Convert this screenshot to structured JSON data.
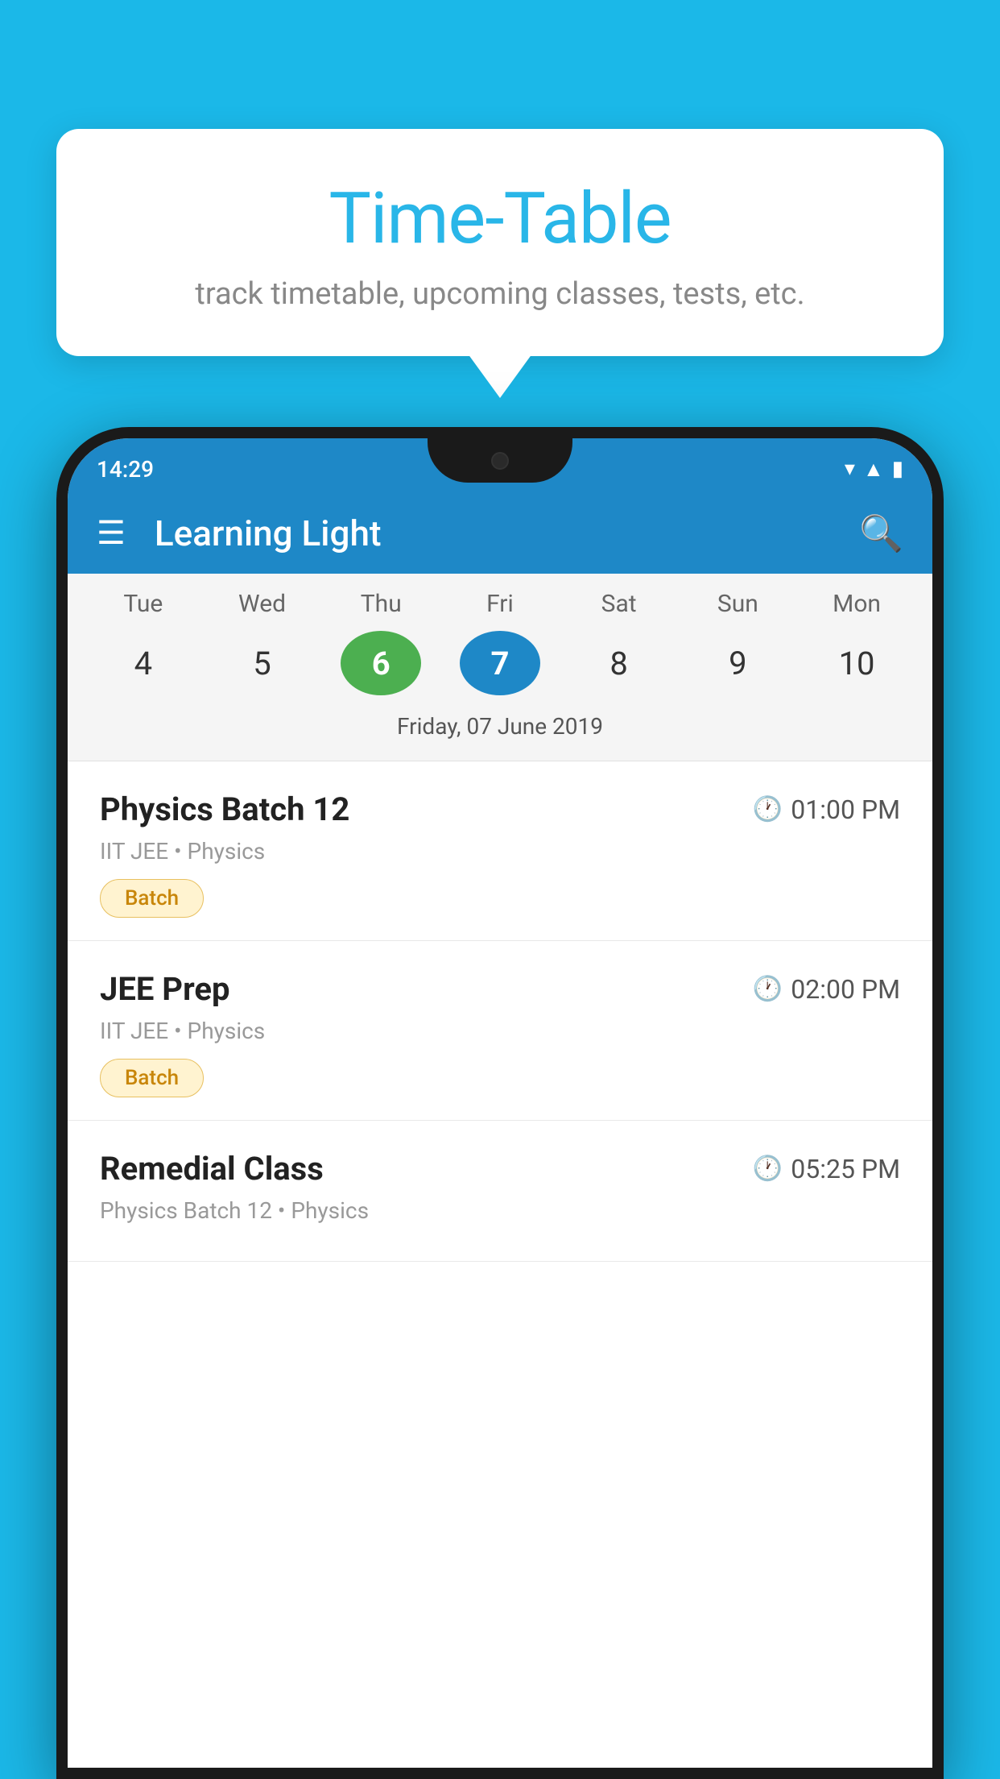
{
  "background": {
    "color": "#1BB8E8"
  },
  "tooltip": {
    "title": "Time-Table",
    "subtitle": "track timetable, upcoming classes, tests, etc."
  },
  "phone": {
    "status_bar": {
      "time": "14:29",
      "signal_icon": "▼▲",
      "battery_icon": "▮"
    },
    "app_header": {
      "title": "Learning Light",
      "menu_icon": "≡",
      "search_icon": "🔍"
    },
    "calendar": {
      "days": [
        {
          "label": "Tue",
          "num": "4"
        },
        {
          "label": "Wed",
          "num": "5"
        },
        {
          "label": "Thu",
          "num": "6",
          "state": "today"
        },
        {
          "label": "Fri",
          "num": "7",
          "state": "selected"
        },
        {
          "label": "Sat",
          "num": "8"
        },
        {
          "label": "Sun",
          "num": "9"
        },
        {
          "label": "Mon",
          "num": "10"
        }
      ],
      "selected_date": "Friday, 07 June 2019"
    },
    "schedule": [
      {
        "name": "Physics Batch 12",
        "time": "01:00 PM",
        "category": "IIT JEE • Physics",
        "badge": "Batch"
      },
      {
        "name": "JEE Prep",
        "time": "02:00 PM",
        "category": "IIT JEE • Physics",
        "badge": "Batch"
      },
      {
        "name": "Remedial Class",
        "time": "05:25 PM",
        "category": "Physics Batch 12 • Physics",
        "badge": null
      }
    ]
  }
}
